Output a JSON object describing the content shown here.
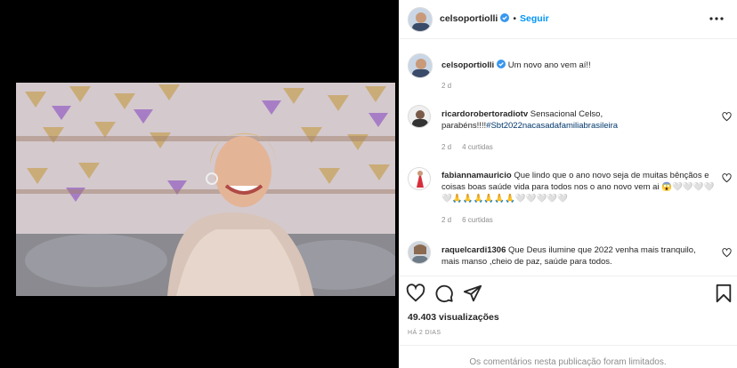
{
  "post": {
    "author": "celsoportiolli",
    "separator": "•",
    "follow_label": "Seguir",
    "caption": "Um novo ano vem aí!!",
    "caption_time": "2 d",
    "views": "49.403 visualizações",
    "posted_ago": "HÁ 2 DIAS",
    "comments_limited": "Os comentários nesta publicação foram limitados."
  },
  "comments": [
    {
      "user": "ricardorobertoradiotv",
      "text": "Sensacional Celso, parabéns!!!!",
      "hashtag": "#Sbt2022nacasadafamiliabrasileira",
      "time": "2 d",
      "likes": "4 curtidas"
    },
    {
      "user": "fabiannamauricio",
      "text": "Que lindo que o ano novo seja de muitas bênçãos e coisas boas saúde vida para todos nos o ano novo vem ai 😱🤍🤍🤍🤍🤍🙏🙏🙏🙏🙏🙏🤍🤍🤍🤍🤍",
      "time": "2 d",
      "likes": "6 curtidas"
    },
    {
      "user": "raquelcardi1306",
      "text": "Que Deus ilumine que 2022 venha mais tranquilo, mais manso ,cheio de paz, saúde para todos."
    }
  ],
  "colors": {
    "accent": "#0095f6",
    "verified": "#3897f0",
    "secondary_text": "#8e8e8e"
  },
  "icons": [
    "verified-badge-icon",
    "more-options-icon",
    "heart-icon",
    "comment-icon",
    "share-icon",
    "bookmark-icon"
  ]
}
